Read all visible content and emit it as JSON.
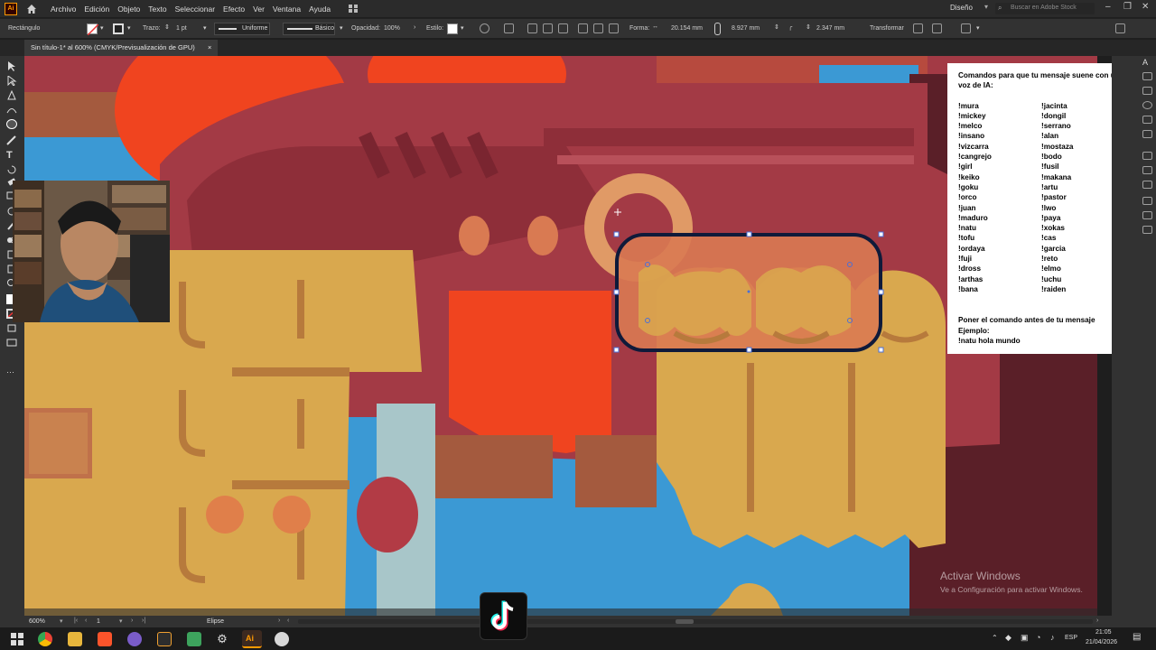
{
  "app": {
    "logo_text": "Ai",
    "menu": [
      "Archivo",
      "Edición",
      "Objeto",
      "Texto",
      "Seleccionar",
      "Efecto",
      "Ver",
      "Ventana",
      "Ayuda"
    ],
    "workspace": "Diseño",
    "stock_search_placeholder": "Buscar en Adobe Stock"
  },
  "control_bar": {
    "object_type": "Rectángulo",
    "stroke_label": "Trazo:",
    "stroke_weight": "1 pt",
    "profile_label": "Uniforme",
    "brush_label": "Básico",
    "opacity_label": "Opacidad:",
    "opacity_value": "100%",
    "style_label": "Estilo:",
    "shape_label": "Forma:",
    "width_value": "20.154 mm",
    "height_value": "8.927 mm",
    "corner_value": "2.347 mm",
    "transform_label": "Transformar"
  },
  "document_tab": {
    "title": "Sin título-1* al 600% (CMYK/Previsualización de GPU)",
    "close": "×"
  },
  "info_panel": {
    "title": "Comandos para que tu mensaje suene con una voz de IA:",
    "commands_left": [
      "!mura",
      "!mickey",
      "!melco",
      "!insano",
      "!vizcarra",
      "!cangrejo",
      "!girl",
      "!keiko",
      "!goku",
      "!orco",
      "!juan",
      "!maduro",
      "!natu",
      "!tofu",
      "!ordaya",
      "!fuji",
      "!dross",
      "!arthas",
      "!bana"
    ],
    "commands_right": [
      "!jacinta",
      "!dongil",
      "!serrano",
      "!alan",
      "!mostaza",
      "!bodo",
      "!fusil",
      "!makana",
      "!artu",
      "!pastor",
      "!lwo",
      "!paya",
      "!xokas",
      "!cas",
      "!garcia",
      "!reto",
      "!elmo",
      "!uchu",
      "!raiden"
    ],
    "instruction": "Poner el comando antes de tu mensaje",
    "example_label": "Ejemplo:",
    "example": "!natu hola mundo"
  },
  "status_bar": {
    "zoom": "600%",
    "page": "1",
    "tool_name": "Elipse"
  },
  "watermark": {
    "title": "Activar Windows",
    "subtitle": "Ve a Configuración para activar Windows."
  },
  "taskbar": {
    "language": "ESP",
    "time": "21:05",
    "date": "21/04/2026"
  },
  "colors": {
    "canvas_blue": "#3b99d4",
    "maroon": "#a33a45",
    "dark_maroon": "#5a1f28",
    "tan": "#d9a84e",
    "orange_red": "#f0441f",
    "selection_stroke": "#0f1a3a",
    "anchor": "#4a6fd8"
  }
}
